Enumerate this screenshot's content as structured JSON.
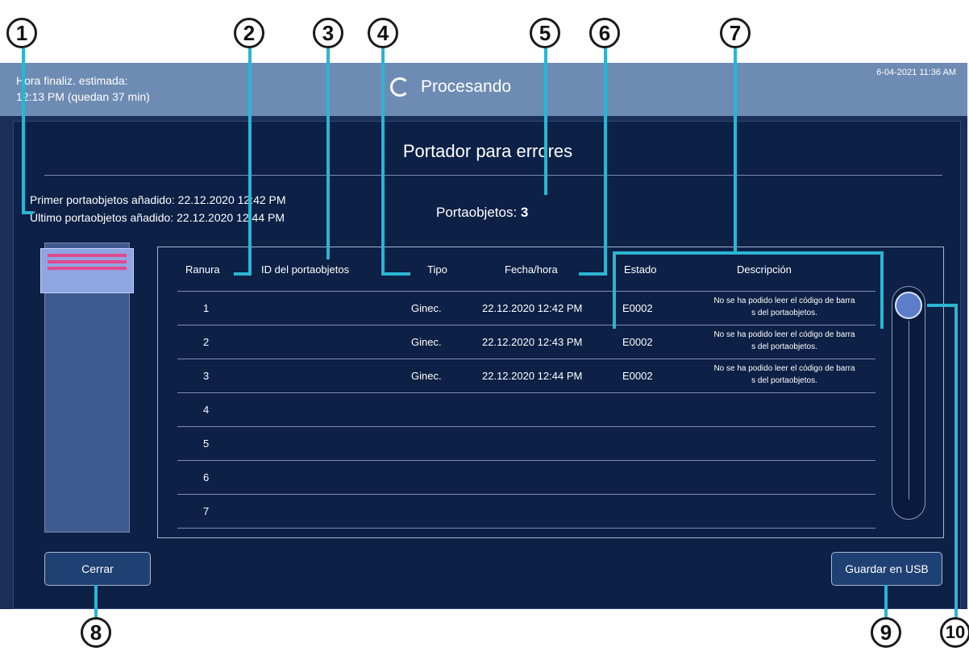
{
  "topbar": {
    "est_label": "Hora finaliz. estimada:",
    "est_value": "12:13 PM (quedan 37 min)",
    "status": "Procesando",
    "datetime": "6-04-2021 11:36 AM"
  },
  "panel": {
    "title": "Portador para errores",
    "first_label": "Primer portaobjetos añadido:",
    "first_value": "22.12.2020 12:42 PM",
    "last_label": "Último portaobjetos añadido:",
    "last_value": "22.12.2020 12:44 PM",
    "count_label": "Portaobjetos:",
    "count_value": "3"
  },
  "table": {
    "headers": [
      "Ranura",
      "ID del portaobjetos",
      "Tipo",
      "Fecha/hora",
      "Estado",
      "Descripción"
    ],
    "rows": [
      {
        "slot": "1",
        "id": "",
        "type": "Ginec.",
        "datetime": "22.12.2020 12:42 PM",
        "status": "E0002",
        "desc1": "No se ha podido leer el código de barra",
        "desc2": "s del portaobjetos."
      },
      {
        "slot": "2",
        "id": "",
        "type": "Ginec.",
        "datetime": "22.12.2020 12:43 PM",
        "status": "E0002",
        "desc1": "No se ha podido leer el código de barra",
        "desc2": "s del portaobjetos."
      },
      {
        "slot": "3",
        "id": "",
        "type": "Ginec.",
        "datetime": "22.12.2020 12:44 PM",
        "status": "E0002",
        "desc1": "No se ha podido leer el código de barra",
        "desc2": "s del portaobjetos."
      },
      {
        "slot": "4",
        "id": "",
        "type": "",
        "datetime": "",
        "status": "",
        "desc1": "",
        "desc2": ""
      },
      {
        "slot": "5",
        "id": "",
        "type": "",
        "datetime": "",
        "status": "",
        "desc1": "",
        "desc2": ""
      },
      {
        "slot": "6",
        "id": "",
        "type": "",
        "datetime": "",
        "status": "",
        "desc1": "",
        "desc2": ""
      },
      {
        "slot": "7",
        "id": "",
        "type": "",
        "datetime": "",
        "status": "",
        "desc1": "",
        "desc2": ""
      }
    ]
  },
  "buttons": {
    "close": "Cerrar",
    "save_usb": "Guardar en USB"
  },
  "callouts": [
    "1",
    "2",
    "3",
    "4",
    "5",
    "6",
    "7",
    "8",
    "9",
    "10"
  ],
  "colors": {
    "accent": "#2bb5d2",
    "topbar": "#6e8bb3",
    "panel": "#0d2046",
    "carrier_stripe": "#e1498e"
  },
  "icons": {
    "status": "spinner-icon"
  }
}
